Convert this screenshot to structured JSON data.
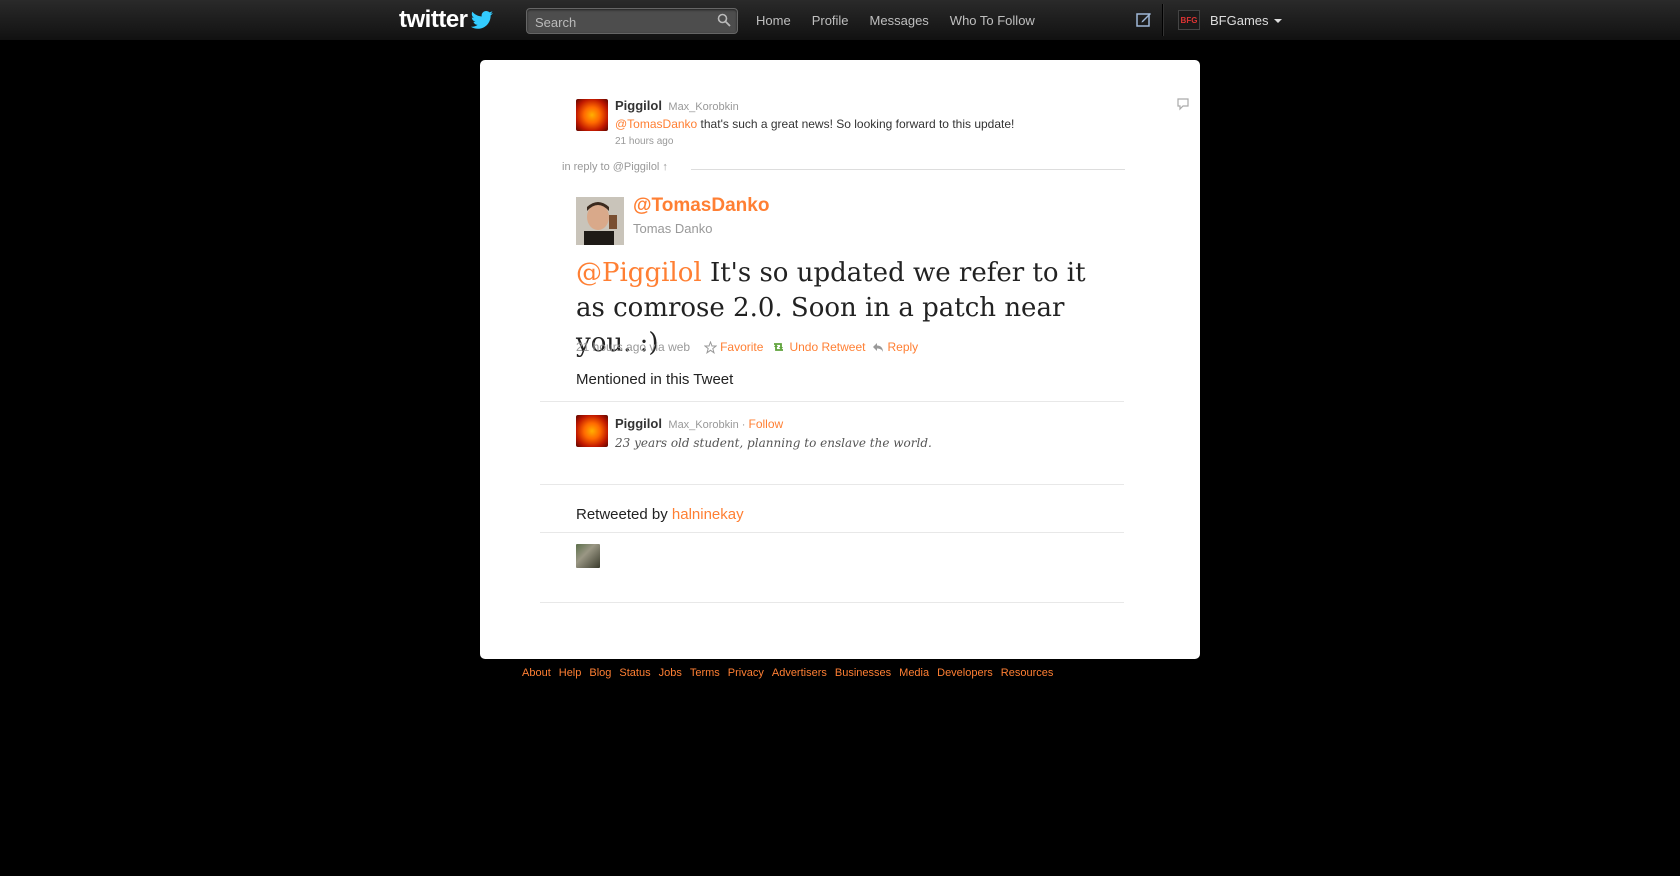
{
  "header": {
    "logo_text": "twitter",
    "search_placeholder": "Search",
    "nav": [
      "Home",
      "Profile",
      "Messages",
      "Who To Follow"
    ],
    "account_badge": "BFG",
    "account_name": "BFGames"
  },
  "original_tweet": {
    "name": "Piggilol",
    "handle": "Max_Korobkin",
    "mention": "@TomasDanko",
    "text": " that's such a great news! So looking forward to this update!",
    "time": "21 hours ago"
  },
  "in_reply_to": "in reply to @Piggilol ↑",
  "main_tweet": {
    "handle": "@TomasDanko",
    "name": "Tomas Danko",
    "mention": "@Piggilol",
    "text": " It's so updated we refer to it as comrose 2.0. Soon in a patch near you. :)",
    "time_via": "21 hours ago via web",
    "actions": {
      "favorite": "Favorite",
      "undo_retweet": "Undo Retweet",
      "reply": "Reply"
    }
  },
  "mentioned": {
    "heading": "Mentioned in this Tweet",
    "name": "Piggilol",
    "handle": "Max_Korobkin",
    "separator": " · ",
    "follow": "Follow",
    "bio": "23 years old student, planning to enslave the world."
  },
  "retweeted": {
    "heading": "Retweeted by ",
    "user": "halninekay"
  },
  "footer": [
    "About",
    "Help",
    "Blog",
    "Status",
    "Jobs",
    "Terms",
    "Privacy",
    "Advertisers",
    "Businesses",
    "Media",
    "Developers",
    "Resources"
  ],
  "colors": {
    "accent": "#ff7f33",
    "retweet_green": "#5fa33b",
    "topbar": "#1a1a1a",
    "background": "#000000"
  }
}
